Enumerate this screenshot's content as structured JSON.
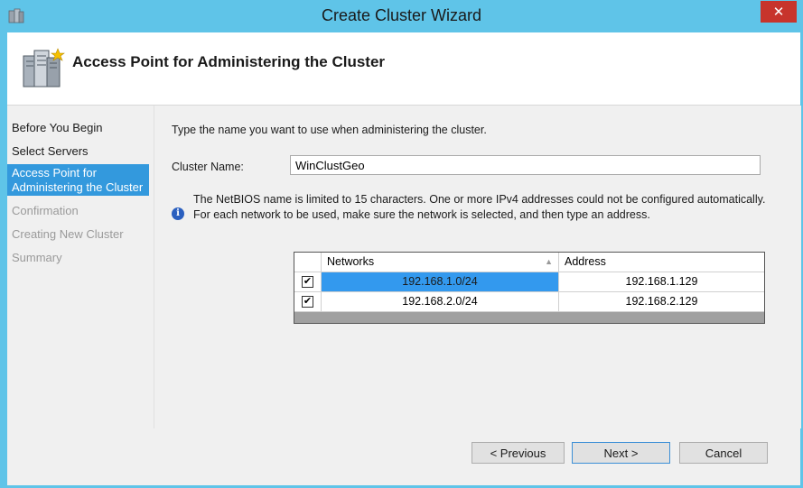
{
  "window": {
    "title": "Create Cluster Wizard",
    "close_glyph": "✕"
  },
  "header": {
    "title": "Access Point for Administering the Cluster",
    "icon": "cluster-servers-icon"
  },
  "nav": {
    "items": [
      {
        "label": "Before You Begin",
        "state": "normal"
      },
      {
        "label": "Select Servers",
        "state": "normal"
      },
      {
        "label": "Access Point for Administering the Cluster",
        "state": "active"
      },
      {
        "label": "Confirmation",
        "state": "disabled"
      },
      {
        "label": "Creating New Cluster",
        "state": "disabled"
      },
      {
        "label": "Summary",
        "state": "disabled"
      }
    ]
  },
  "content": {
    "instructions": "Type the name you want to use when administering the cluster.",
    "cluster_name_label": "Cluster Name:",
    "cluster_name_value": "WinClustGeo",
    "info_glyph": "i",
    "info_text": "The NetBIOS name is limited to 15 characters.  One or more IPv4 addresses could not be configured automatically.  For each network to be used, make sure the network is selected, and then type an address.",
    "grid": {
      "columns": [
        "Networks",
        "Address"
      ],
      "sort_glyph": "▲",
      "check_glyph": "✔",
      "rows": [
        {
          "checked": true,
          "network": "192.168.1.0/24",
          "address": "192.168.1.129",
          "selected": true
        },
        {
          "checked": true,
          "network": "192.168.2.0/24",
          "address": "192.168.2.129",
          "selected": false
        }
      ]
    }
  },
  "buttons": {
    "previous": "< Previous",
    "next": "Next >",
    "cancel": "Cancel"
  },
  "colors": {
    "title_bar": "#5fc4e8",
    "nav_active": "#3399dd",
    "close": "#c7342c",
    "selection": "#3399ee"
  }
}
